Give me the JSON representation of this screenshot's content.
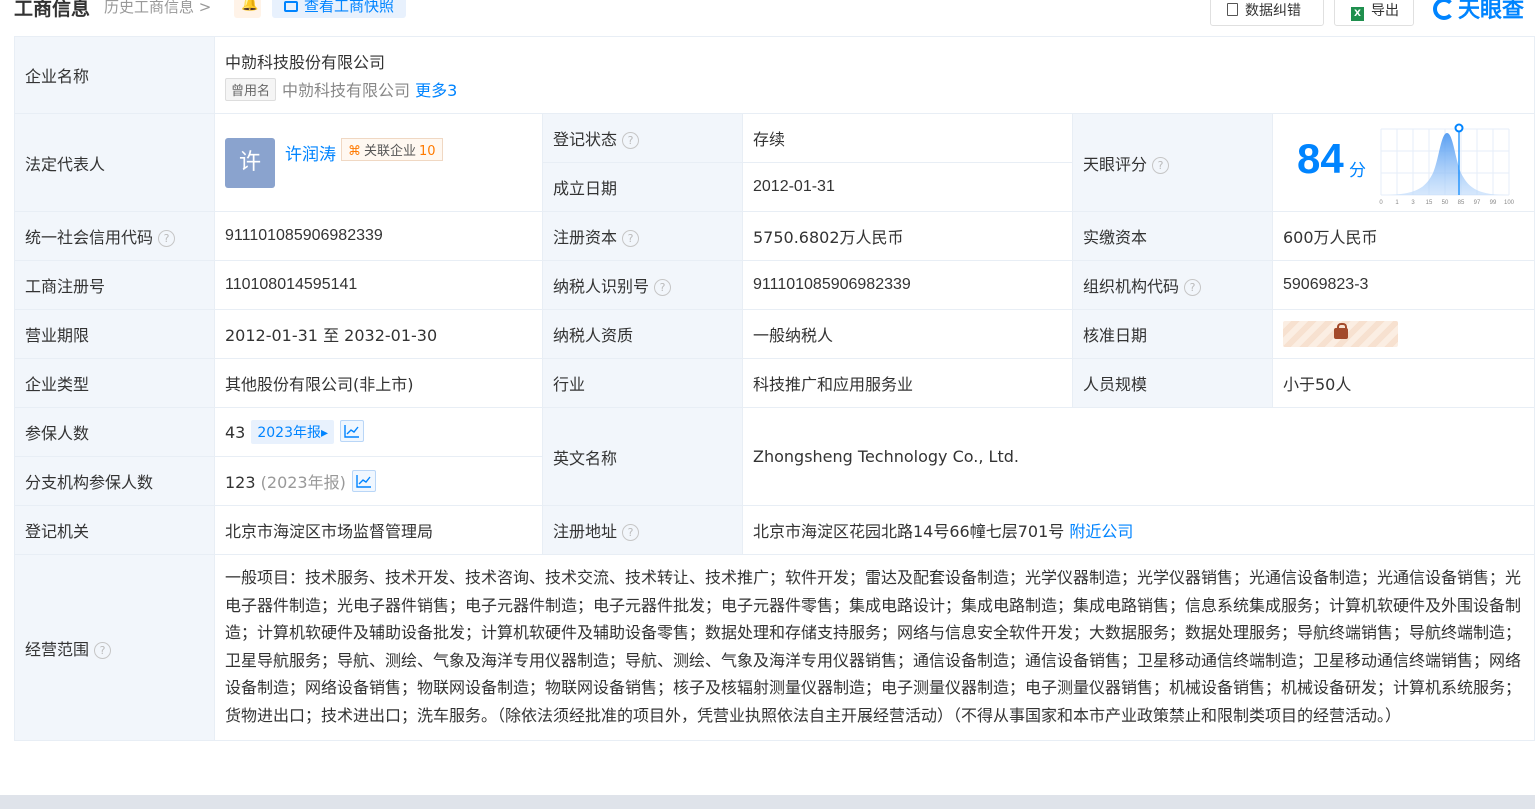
{
  "header": {
    "title": "工商信息",
    "history": "历史工商信息",
    "snapshot": "查看工商快照",
    "correction": "数据纠错",
    "export": "导出",
    "brand": "天眼查"
  },
  "company": {
    "label": "企业名称",
    "name": "中勍科技股份有限公司",
    "alias_tag": "曾用名",
    "alias": "中勍科技有限公司",
    "more": "更多3"
  },
  "legal": {
    "label": "法定代表人",
    "avatar": "许",
    "name": "许润涛",
    "related_label": "关联企业",
    "related_count": "10"
  },
  "reg_status": {
    "label": "登记状态",
    "value": "存续"
  },
  "found_date": {
    "label": "成立日期",
    "value": "2012-01-31"
  },
  "score": {
    "label": "天眼评分",
    "value": "84",
    "unit": "分",
    "ticks": [
      "0",
      "1",
      "3",
      "15",
      "50",
      "85",
      "97",
      "99",
      "100"
    ]
  },
  "credit_code": {
    "label": "统一社会信用代码",
    "value": "911101085906982339"
  },
  "reg_capital": {
    "label": "注册资本",
    "value": "5750.6802万人民币"
  },
  "paid_capital": {
    "label": "实缴资本",
    "value": "600万人民币"
  },
  "reg_no": {
    "label": "工商注册号",
    "value": "110108014595141"
  },
  "taxpayer_id": {
    "label": "纳税人识别号",
    "value": "911101085906982339"
  },
  "org_code": {
    "label": "组织机构代码",
    "value": "59069823-3"
  },
  "term": {
    "label": "营业期限",
    "value": "2012-01-31 至 2032-01-30"
  },
  "taxpayer_qual": {
    "label": "纳税人资质",
    "value": "一般纳税人"
  },
  "approve_date": {
    "label": "核准日期"
  },
  "type": {
    "label": "企业类型",
    "value": "其他股份有限公司(非上市)"
  },
  "industry": {
    "label": "行业",
    "value": "科技推广和应用服务业"
  },
  "staff": {
    "label": "人员规模",
    "value": "小于50人"
  },
  "insured": {
    "label": "参保人数",
    "value": "43",
    "year": "2023年报"
  },
  "branch_insured": {
    "label": "分支机构参保人数",
    "value": "123",
    "year": "(2023年报)"
  },
  "english": {
    "label": "英文名称",
    "value": "Zhongsheng Technology Co., Ltd."
  },
  "authority": {
    "label": "登记机关",
    "value": "北京市海淀区市场监督管理局"
  },
  "address": {
    "label": "注册地址",
    "value": "北京市海淀区花园北路14号66幢七层701号",
    "nearby": "附近公司"
  },
  "scope": {
    "label": "经营范围",
    "value": "一般项目：技术服务、技术开发、技术咨询、技术交流、技术转让、技术推广；软件开发；雷达及配套设备制造；光学仪器制造；光学仪器销售；光通信设备制造；光通信设备销售；光电子器件制造；光电子器件销售；电子元器件制造；电子元器件批发；电子元器件零售；集成电路设计；集成电路制造；集成电路销售；信息系统集成服务；计算机软硬件及外围设备制造；计算机软硬件及辅助设备批发；计算机软硬件及辅助设备零售；数据处理和存储支持服务；网络与信息安全软件开发；大数据服务；数据处理服务；导航终端销售；导航终端制造；卫星导航服务；导航、测绘、气象及海洋专用仪器制造；导航、测绘、气象及海洋专用仪器销售；通信设备制造；通信设备销售；卫星移动通信终端制造；卫星移动通信终端销售；网络设备制造；网络设备销售；物联网设备制造；物联网设备销售；核子及核辐射测量仪器制造；电子测量仪器制造；电子测量仪器销售；机械设备销售；机械设备研发；计算机系统服务；货物进出口；技术进出口；洗车服务。（除依法须经批准的项目外，凭营业执照依法自主开展经营活动）（不得从事国家和本市产业政策禁止和限制类项目的经营活动。）"
  }
}
